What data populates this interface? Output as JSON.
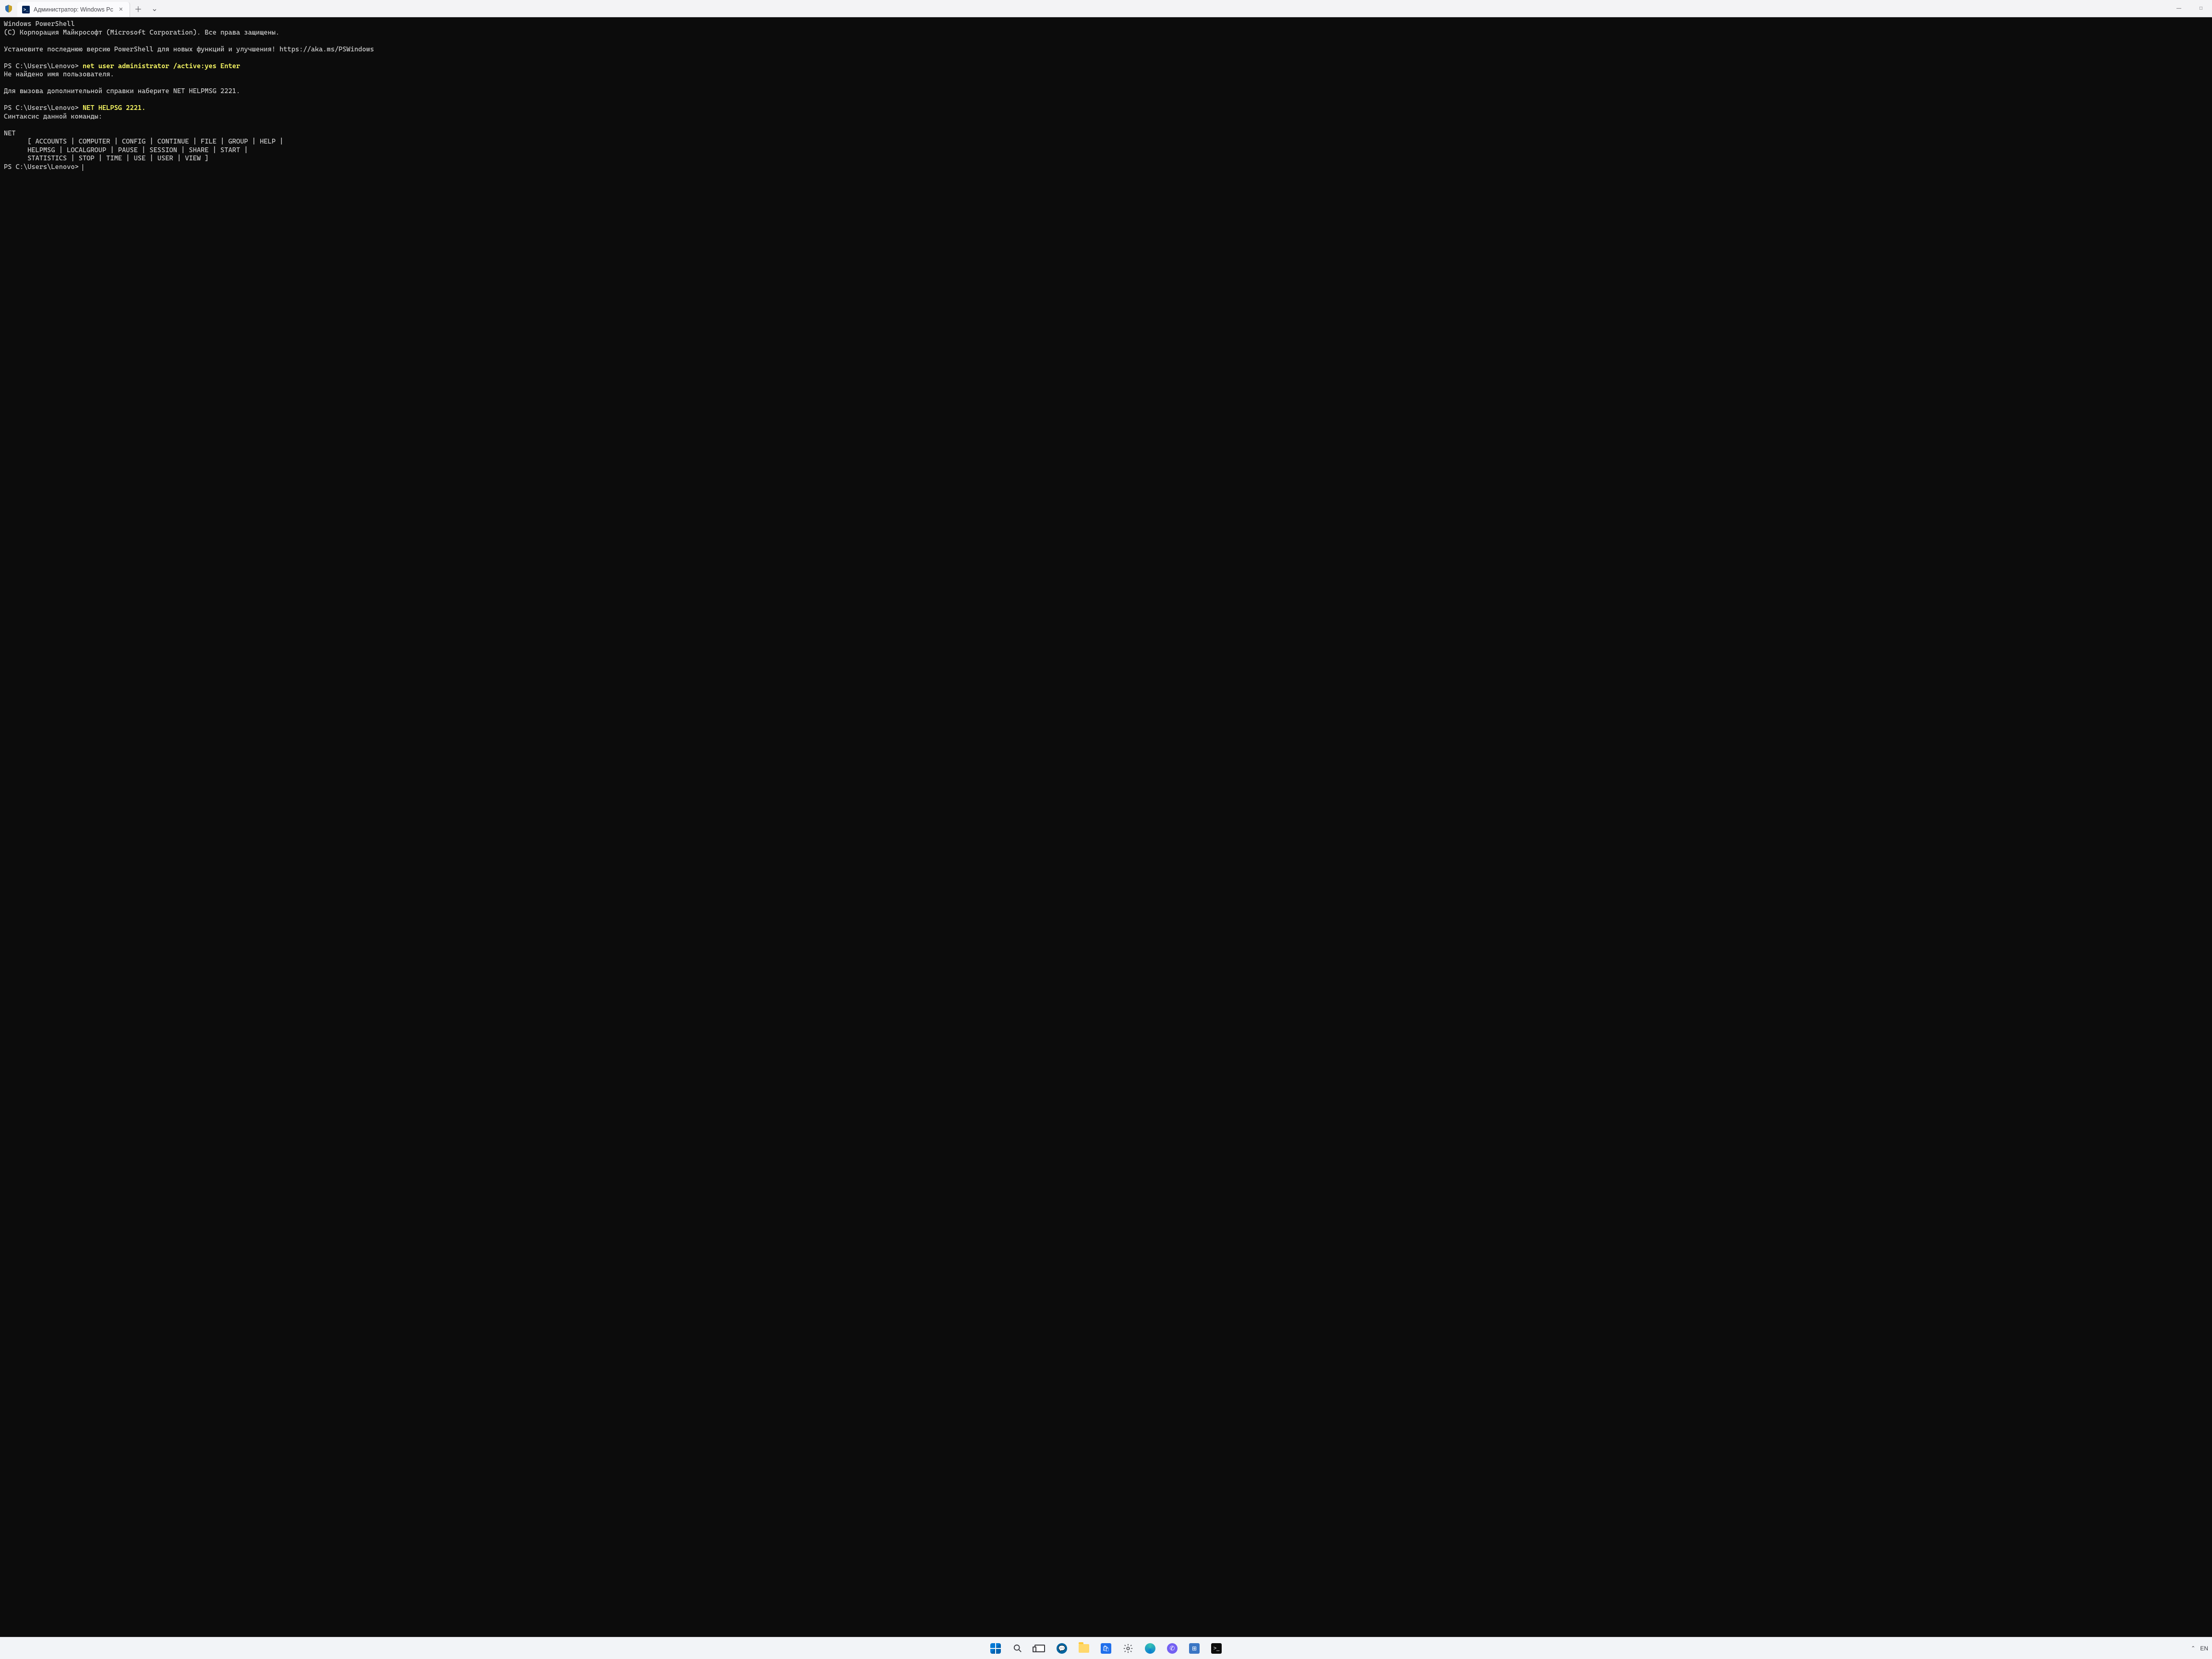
{
  "titlebar": {
    "tab_title": "Администратор: Windows Pc",
    "tab_icon_text": ">_",
    "close_glyph": "✕",
    "new_tab_glyph": "＋",
    "tab_menu_glyph": "⌄",
    "min_glyph": "—",
    "max_glyph": "□"
  },
  "terminal": {
    "line1": "Windows PowerShell",
    "line2": "(C) Корпорация Майкрософт (Microsoft Corporation). Все права защищены.",
    "blank": "",
    "line3": "Установите последнюю версию PowerShell для новых функций и улучшения! https://aka.ms/PSWindows",
    "prompt1": "PS C:\\Users\\Lenovo> ",
    "cmd1": "net user administrator /active:yes Enter",
    "err1": "Не найдено имя пользователя.",
    "err2": "Для вызова дополнительной справки наберите NET HELPMSG 2221.",
    "prompt2": "PS C:\\Users\\Lenovo> ",
    "cmd2": "NET HELPSG 2221.",
    "syntax_header": "Синтаксис данной команды:",
    "net_root": "NET",
    "net_line1": "      [ ACCOUNTS | COMPUTER | CONFIG | CONTINUE | FILE | GROUP | HELP |",
    "net_line2": "      HELPMSG | LOCALGROUP | PAUSE | SESSION | SHARE | START |",
    "net_line3": "      STATISTICS | STOP | TIME | USE | USER | VIEW ]",
    "prompt3": "PS C:\\Users\\Lenovo> "
  },
  "taskbar": {
    "tray_expand_glyph": "⌃",
    "lang": "EN"
  }
}
